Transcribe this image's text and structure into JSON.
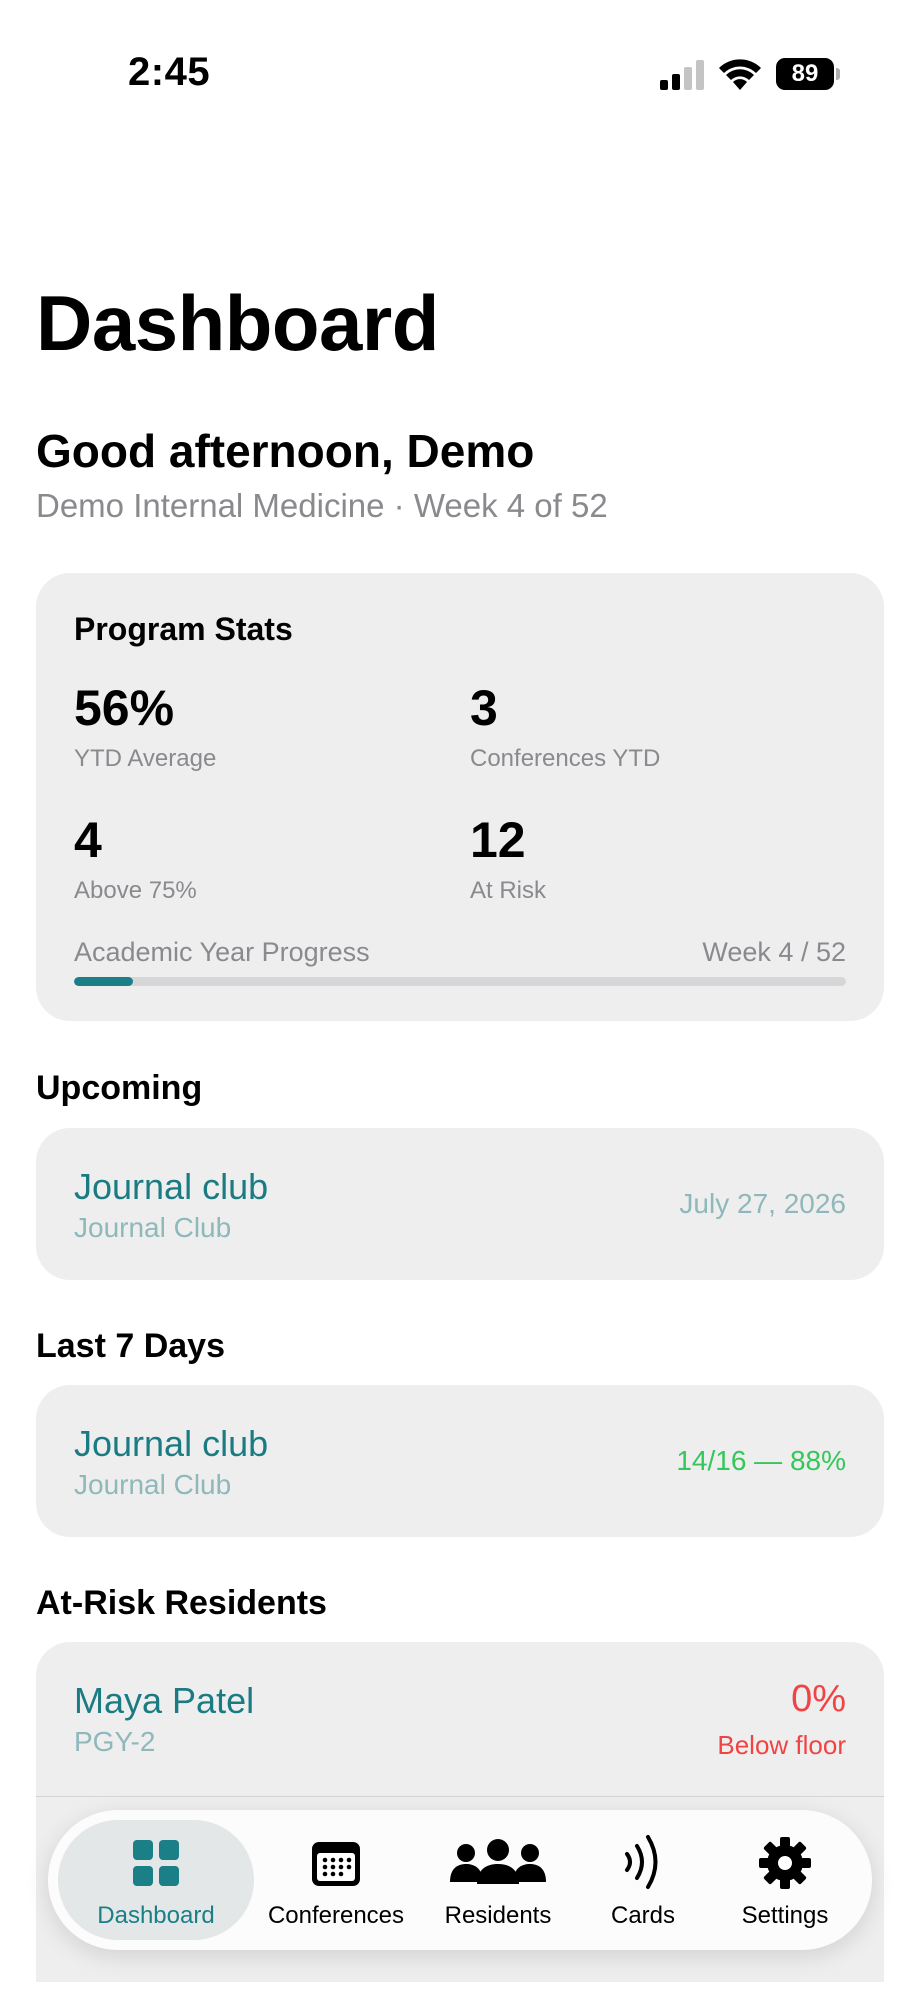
{
  "status_bar": {
    "time": "2:45",
    "battery": "89"
  },
  "page": {
    "title": "Dashboard"
  },
  "greeting": "Good afternoon, Demo",
  "subtitle": "Demo Internal Medicine · Week 4 of 52",
  "program_stats": {
    "title": "Program Stats",
    "ytd_average": {
      "value": "56%",
      "label": "YTD Average"
    },
    "conferences_ytd": {
      "value": "3",
      "label": "Conferences YTD"
    },
    "above_75": {
      "value": "4",
      "label": "Above 75%"
    },
    "at_risk": {
      "value": "12",
      "label": "At Risk"
    },
    "progress": {
      "label": "Academic Year Progress",
      "week_text": "Week 4 / 52",
      "fraction": 0.0769
    }
  },
  "upcoming": {
    "header": "Upcoming",
    "item": {
      "title": "Journal club",
      "subtitle": "Journal Club",
      "date": "July 27, 2026"
    }
  },
  "last7": {
    "header": "Last 7 Days",
    "item": {
      "title": "Journal club",
      "subtitle": "Journal Club",
      "attendance": "14/16 — 88%"
    }
  },
  "at_risk_residents": {
    "header": "At-Risk Residents",
    "items": [
      {
        "name": "Maya Patel",
        "level": "PGY-2",
        "score": "0%",
        "status": "Below floor"
      }
    ]
  },
  "tabs": [
    {
      "label": "Dashboard",
      "icon": "grid-icon",
      "active": true
    },
    {
      "label": "Conferences",
      "icon": "calendar-icon",
      "active": false
    },
    {
      "label": "Residents",
      "icon": "people-icon",
      "active": false
    },
    {
      "label": "Cards",
      "icon": "nfc-icon",
      "active": false
    },
    {
      "label": "Settings",
      "icon": "gear-icon",
      "active": false
    }
  ],
  "colors": {
    "accent": "#1a7f86",
    "success": "#34c759",
    "danger": "#f04444",
    "muted": "#8a8a8e"
  }
}
